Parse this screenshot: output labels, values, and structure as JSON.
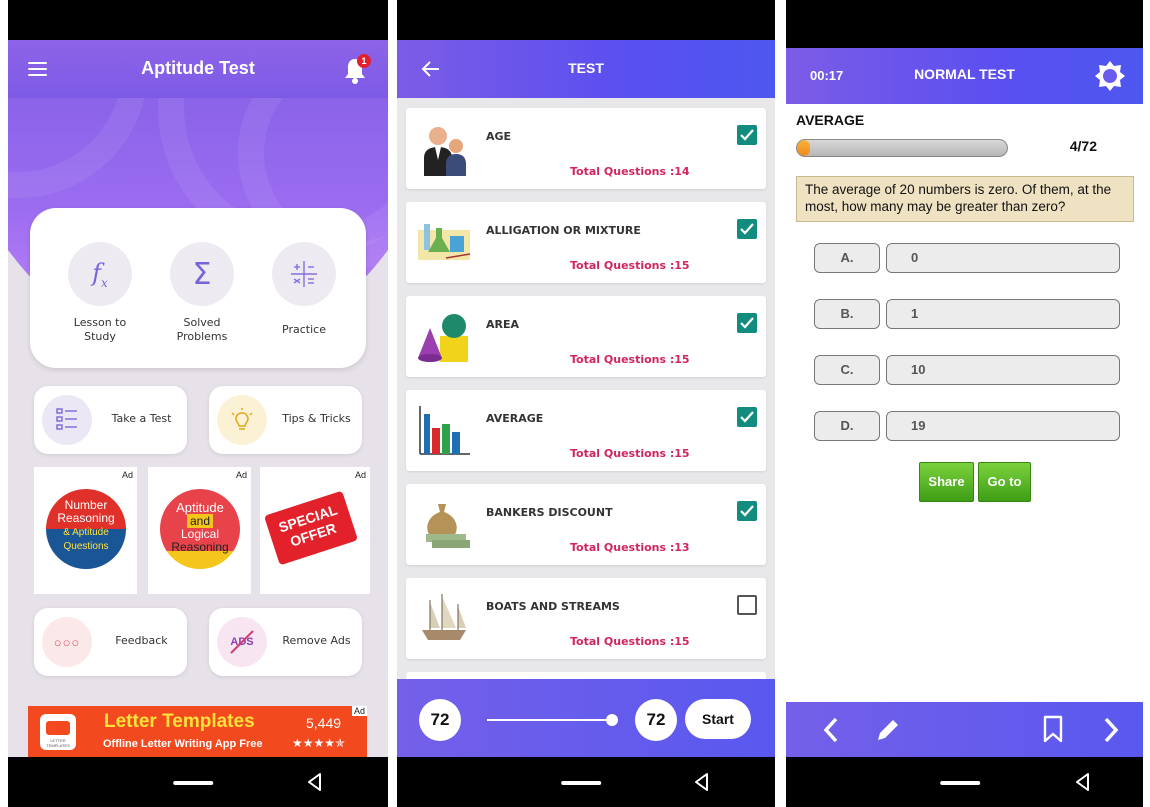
{
  "screen1": {
    "title": "Aptitude Test",
    "notification_count": "1",
    "main_items": [
      "Lesson to Study",
      "Solved Problems",
      "Practice"
    ],
    "main_item_lines": [
      [
        "Lesson to",
        "Study"
      ],
      [
        "Solved",
        "Problems"
      ],
      [
        "Practice",
        ""
      ]
    ],
    "take_test_label": "Take a Test",
    "tips_label": "Tips & Tricks",
    "ad_label": "Ad",
    "ad1": {
      "line1": "Number",
      "line2": "Reasoning",
      "line3": "& Aptitude",
      "line4": "Questions"
    },
    "ad2": {
      "line1": "Aptitude",
      "line2": "and",
      "line3": "Logical",
      "line4": "Reasoning"
    },
    "ad3": {
      "line1": "SPECIAL",
      "line2": "OFFER"
    },
    "feedback_label": "Feedback",
    "remove_ads_label": "Remove Ads",
    "ads_icon_text": "ADS",
    "banner": {
      "title": "Letter Templates",
      "subtitle": "Offline Letter Writing App Free",
      "rating_count": "5,449",
      "stars": "★★★★✯",
      "logo_text": "LETTER TEMPLATES"
    },
    "colors": {
      "accent": "#7d5ae6",
      "background": "#e7e2e9"
    }
  },
  "screen2": {
    "title": "TEST",
    "topics": [
      {
        "name": "AGE",
        "count": "Total Questions :14",
        "checked": true,
        "icon": "people-icon"
      },
      {
        "name": "ALLIGATION OR MIXTURE",
        "count": "Total Questions :15",
        "checked": true,
        "icon": "flask-icon"
      },
      {
        "name": "AREA",
        "count": "Total Questions :15",
        "checked": true,
        "icon": "shapes-icon"
      },
      {
        "name": "AVERAGE",
        "count": "Total Questions :15",
        "checked": true,
        "icon": "bar-chart-icon"
      },
      {
        "name": "BANKERS DISCOUNT",
        "count": "Total Questions :13",
        "checked": true,
        "icon": "money-bag-icon"
      },
      {
        "name": "BOATS AND STREAMS",
        "count": "Total Questions :15",
        "checked": false,
        "icon": "ship-icon"
      }
    ],
    "min_questions": "72",
    "selected_questions": "72",
    "start_label": "Start",
    "colors": {
      "check": "#128c7e",
      "count_text": "#d0265e"
    }
  },
  "screen3": {
    "timer": "00:17",
    "title": "NORMAL TEST",
    "section": "AVERAGE",
    "progress_text": "4/72",
    "progress_fraction": 0.056,
    "question": "The average of 20 numbers is zero. Of them, at the most, how many may be greater than zero?",
    "options": [
      {
        "letter": "A.",
        "text": "0"
      },
      {
        "letter": "B.",
        "text": "1"
      },
      {
        "letter": "C.",
        "text": "10"
      },
      {
        "letter": "D.",
        "text": "19"
      }
    ],
    "share_label": "Share",
    "goto_label": "Go to",
    "colors": {
      "question_bg": "#efe2c2",
      "button_green": "#4aa81c"
    }
  }
}
